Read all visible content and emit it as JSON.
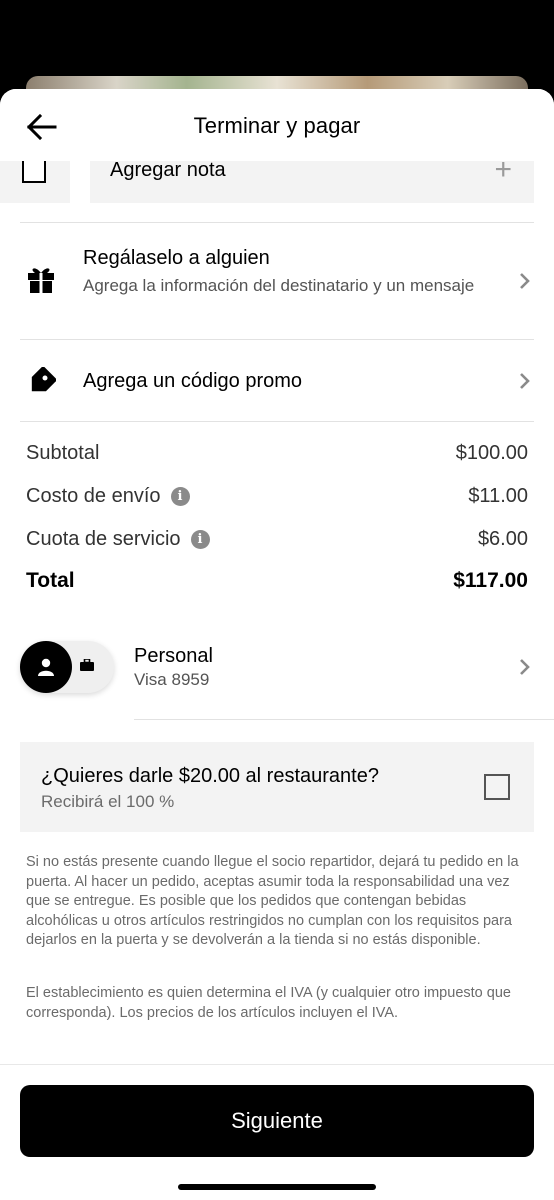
{
  "header": {
    "title": "Terminar y pagar"
  },
  "note": {
    "label": "Agregar nota",
    "plus": "+"
  },
  "gift": {
    "title": "Regálaselo a alguien",
    "subtitle": "Agrega la información del destinatario y un mensaje"
  },
  "promo": {
    "title": "Agrega un código promo"
  },
  "summary": {
    "subtotal_label": "Subtotal",
    "subtotal_value": "$100.00",
    "delivery_label": "Costo de envío",
    "delivery_value": "$11.00",
    "service_label": "Cuota de servicio",
    "service_value": "$6.00",
    "total_label": "Total",
    "total_value": "$117.00"
  },
  "payment": {
    "profile": "Personal",
    "card": "Visa 8959"
  },
  "tip": {
    "title": "¿Quieres darle $20.00 al restaurante?",
    "subtitle": "Recibirá el 100 %"
  },
  "legal": {
    "p1": "Si no estás presente cuando llegue el socio repartidor, dejará tu pedido en la puerta. Al hacer un pedido, aceptas asumir toda la responsabilidad una vez que se entregue. Es posible que los pedidos que contengan bebidas alcohólicas u otros artículos restringidos no cumplan con los requisitos para dejarlos en la puerta y se devolverán a la tienda si no estás disponible.",
    "p2": "El establecimiento es quien determina el IVA (y cualquier otro impuesto que corresponda). Los precios de los artículos incluyen el IVA."
  },
  "footer": {
    "button_label": "Siguiente"
  },
  "icons": {
    "back": "arrow-left-icon",
    "gift": "gift-icon",
    "promo": "tag-icon",
    "chevron": "chevron-right-icon",
    "info": "info-icon",
    "person": "person-icon",
    "briefcase": "briefcase-icon"
  }
}
